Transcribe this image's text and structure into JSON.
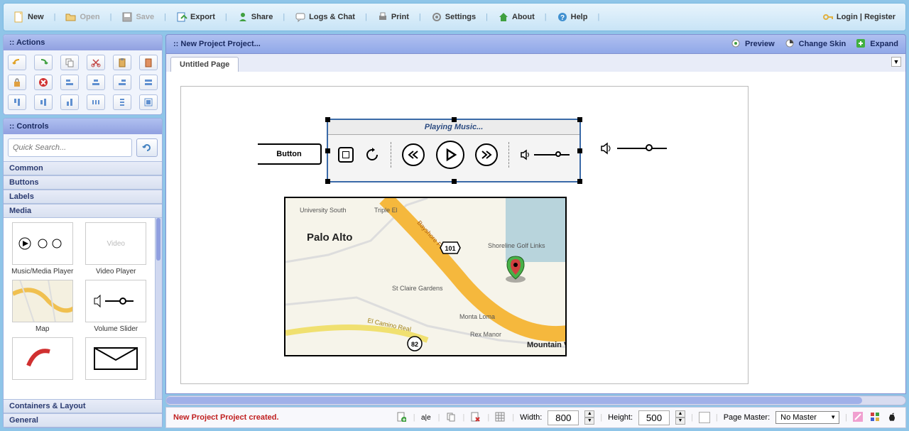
{
  "topbar": {
    "new_label": "New",
    "open_label": "Open",
    "save_label": "Save",
    "export_label": "Export",
    "share_label": "Share",
    "logs_label": "Logs & Chat",
    "print_label": "Print",
    "settings_label": "Settings",
    "about_label": "About",
    "help_label": "Help",
    "login_label": "Login | Register"
  },
  "sidebar": {
    "actions_title": ":: Actions",
    "controls_title": ":: Controls",
    "search_placeholder": "Quick Search...",
    "categories": [
      "Common",
      "Buttons",
      "Labels",
      "Media",
      "Containers & Layout",
      "General"
    ],
    "media_items": [
      {
        "label": "Music/Media Player"
      },
      {
        "label": "Video Player"
      },
      {
        "label": "Map"
      },
      {
        "label": "Volume Slider"
      }
    ]
  },
  "workarea": {
    "project_title": ":: New Project Project...",
    "preview_label": "Preview",
    "skin_label": "Change Skin",
    "expand_label": "Expand",
    "tab_label": "Untitled Page"
  },
  "canvas": {
    "button_label": "Button",
    "media_title": "Playing Music..."
  },
  "status": {
    "message": "New Project Project created.",
    "width_label": "Width:",
    "width_value": "800",
    "height_label": "Height:",
    "height_value": "500",
    "master_label": "Page Master:",
    "master_value": "No Master"
  },
  "map_labels": {
    "palo_alto": "Palo Alto",
    "university": "University South",
    "triple_el": "Triple El",
    "shoreline": "Shoreline Golf Links",
    "st_claire": "St Claire Gardens",
    "monta_loma": "Monta Loma",
    "rex_manor": "Rex Manor",
    "mountain_view": "Mountain View",
    "bayshore": "Bayshore Fwy",
    "el_camino": "El Camino Real",
    "hwy101": "101",
    "hwy82": "82"
  }
}
